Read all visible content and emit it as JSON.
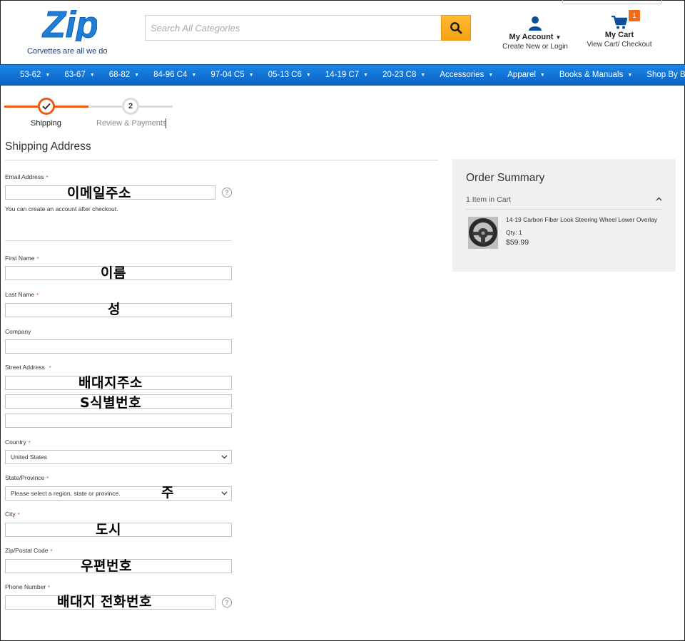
{
  "header": {
    "logo_text": "Zip",
    "tagline": "Corvettes are all we do",
    "search_placeholder": "Search All Categories",
    "account_title": "My Account",
    "account_sub": "Create New or Login",
    "cart_title": "My Cart",
    "cart_sub": "View Cart/ Checkout",
    "cart_count": "1"
  },
  "nav": {
    "items": [
      "53-62",
      "63-67",
      "68-82",
      "84-96 C4",
      "97-04 C5",
      "05-13 C6",
      "14-19 C7",
      "20-23 C8",
      "Accessories",
      "Apparel",
      "Books & Manuals",
      "Shop By Brand"
    ]
  },
  "progress": {
    "step1_label": "Shipping",
    "step2_number": "2",
    "step2_label": "Review & Payments"
  },
  "form": {
    "section_title": "Shipping Address",
    "required_mark": "*",
    "email_label": "Email Address",
    "email_overlay": "이메일주소",
    "email_note": "You can create an account after checkout.",
    "help_glyph": "?",
    "first_name_label": "First Name",
    "first_name_overlay": "이름",
    "last_name_label": "Last Name",
    "last_name_overlay": "성",
    "company_label": "Company",
    "street_label": "Street Address",
    "street_overlay_1": "배대지주소",
    "street_overlay_2": "S식별번호",
    "country_label": "Country",
    "country_value": "United States",
    "state_label": "State/Province",
    "state_value": "Please select a region, state or province.",
    "state_overlay": "주",
    "city_label": "City",
    "city_overlay": "도시",
    "zip_label": "Zip/Postal Code",
    "zip_overlay": "우편번호",
    "phone_label": "Phone Number",
    "phone_overlay": "배대지 전화번호"
  },
  "summary": {
    "title": "Order Summary",
    "count": "1 Item in Cart",
    "product_name": "14-19 Carbon Fiber Look Steering Wheel Lower Overlay",
    "product_qty": "Qty: 1",
    "product_price": "$59.99"
  },
  "colors": {
    "accent_orange": "#ef5b14",
    "nav_blue": "#0b63c8",
    "search_button": "#f6a012",
    "required": "#e02b27"
  }
}
